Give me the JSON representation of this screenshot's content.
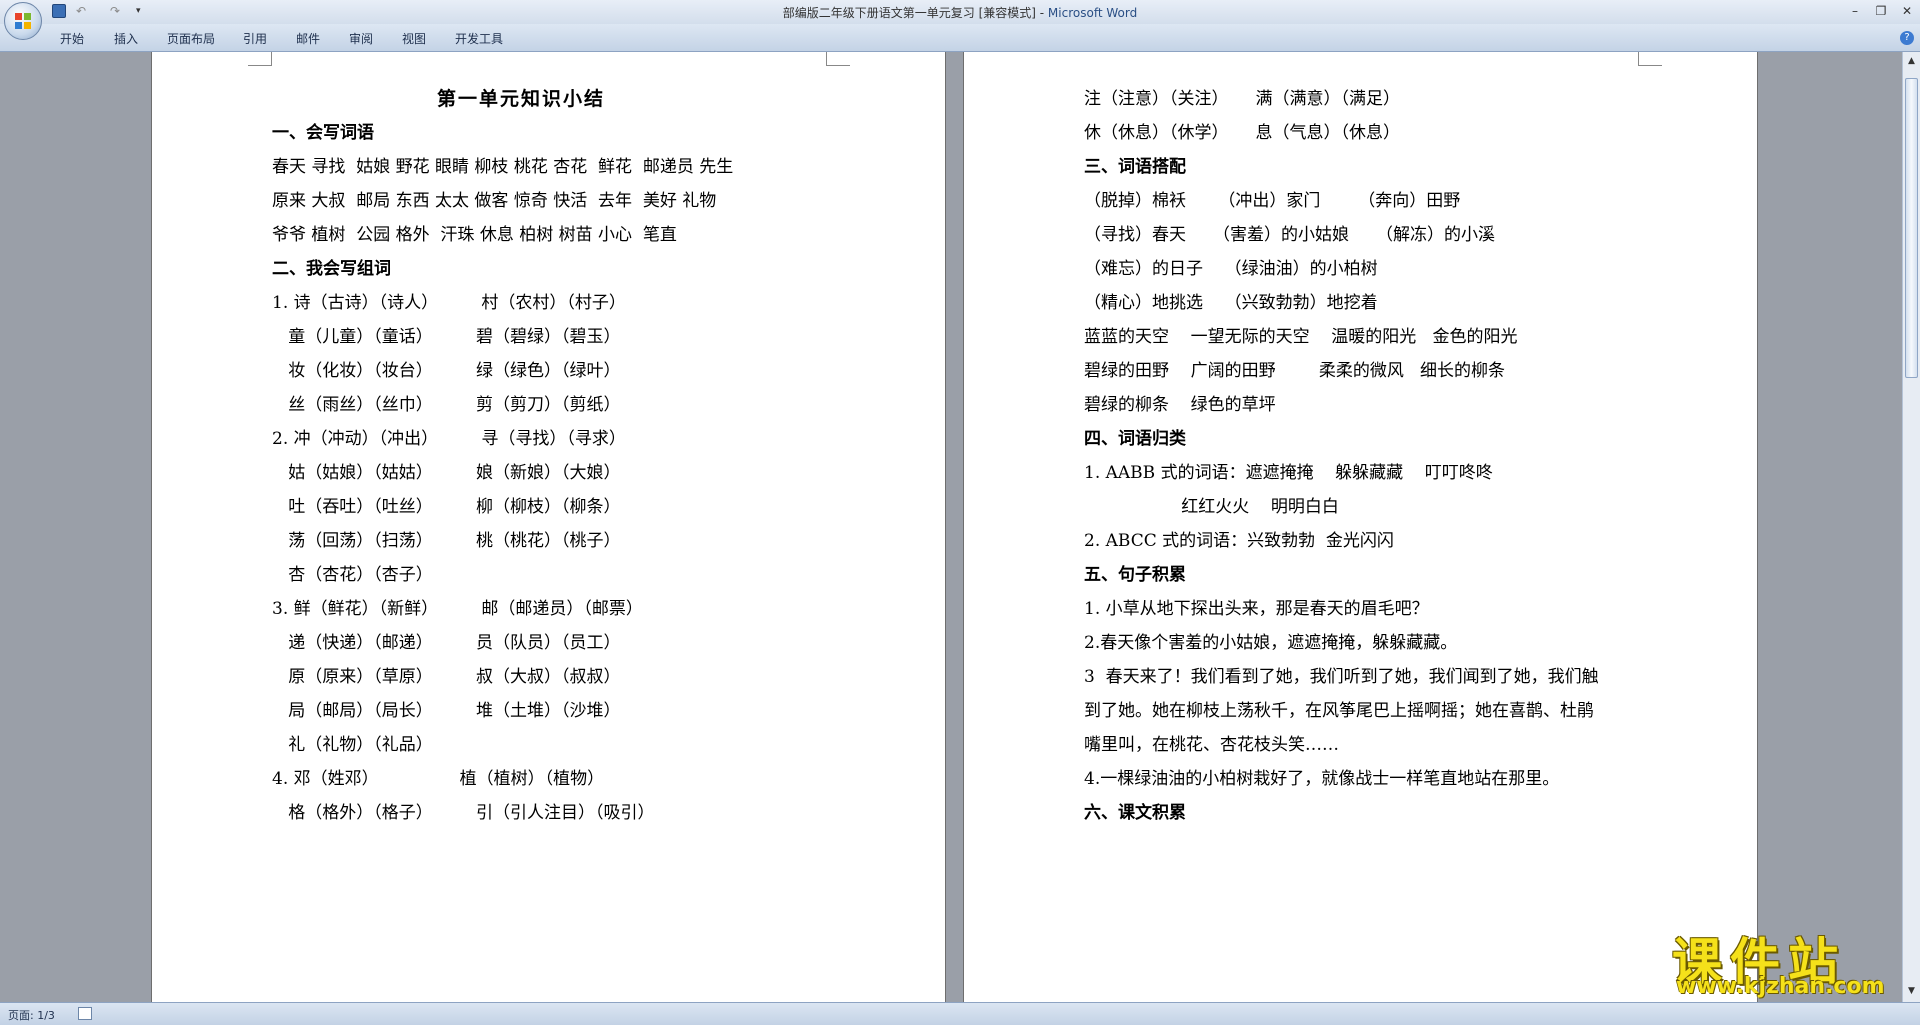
{
  "window": {
    "title_doc": "部编版二年级下册语文第一单元复习 [兼容模式] - ",
    "title_app": "Microsoft Word",
    "controls": [
      "–",
      "❐",
      "✕"
    ]
  },
  "qat": {
    "undo": "↶",
    "redo": "↷",
    "more": "▾"
  },
  "ribbon": {
    "tabs": [
      "开始",
      "插入",
      "页面布局",
      "引用",
      "邮件",
      "审阅",
      "视图",
      "开发工具"
    ],
    "help": "?"
  },
  "left_page": {
    "title": "第一单元知识小结",
    "lines": [
      "一、会写词语",
      "春天 寻找  姑娘 野花 眼睛 柳枝 桃花 杏花  鲜花  邮递员 先生",
      "原来 大叔  邮局 东西 太太 做客 惊奇 快活  去年  美好 礼物",
      "爷爷 植树  公园 格外  汗珠 休息 柏树 树苗 小心  笔直",
      "二、我会写组词",
      "1. 诗（古诗）（诗人）        村（农村）（村子）",
      "   童（儿童）（童话）        碧（碧绿）（碧玉）",
      "   妆（化妆）（妆台）        绿（绿色）（绿叶）",
      "   丝（雨丝）（丝巾）        剪（剪刀）（剪纸）",
      "2. 冲（冲动）（冲出）        寻（寻找）（寻求）",
      "   姑（姑娘）（姑姑）        娘（新娘）（大娘）",
      "   吐（吞吐）（吐丝）        柳（柳枝）（柳条）",
      "   荡（回荡）（扫荡）        桃（桃花）（桃子）",
      "   杏（杏花）（杏子）",
      "3. 鲜（鲜花）（新鲜）        邮（邮递员）（邮票）",
      "   递（快递）（邮递）        员（队员）（员工）",
      "   原（原来）（草原）        叔（大叔）（叔叔）",
      "   局（邮局）（局长）        堆（土堆）（沙堆）",
      "   礼（礼物）（礼品）",
      "4. 邓（姓邓）               植（植树）（植物）",
      "   格（格外）（格子）        引（引人注目）（吸引）"
    ]
  },
  "right_page": {
    "lines": [
      "注（注意）（关注）     满（满意）（满足）",
      "休（休息）（休学）     息（气息）（休息）",
      "三、词语搭配",
      "（脱掉）棉袄      （冲出）家门       （奔向）田野",
      "（寻找）春天     （害羞）的小姑娘     （解冻）的小溪",
      "（难忘）的日子    （绿油油）的小柏树",
      "（精心）地挑选    （兴致勃勃）地挖着",
      "蓝蓝的天空    一望无际的天空    温暖的阳光   金色的阳光",
      "碧绿的田野    广阔的田野        柔柔的微风   细长的柳条",
      "碧绿的柳条    绿色的草坪",
      "四、词语归类",
      "1. AABB 式的词语：遮遮掩掩    躲躲藏藏    叮叮咚咚",
      "                  红红火火    明明白白",
      "2. ABCC 式的词语：兴致勃勃  金光闪闪",
      "五、句子积累",
      "1. 小草从地下探出头来，那是春天的眉毛吧？",
      "2.春天像个害羞的小姑娘，遮遮掩掩，躲躲藏藏。",
      "3  春天来了！我们看到了她，我们听到了她，我们闻到了她，我们触",
      "到了她。她在柳枝上荡秋千，在风筝尾巴上摇啊摇；她在喜鹊、杜鹃",
      "嘴里叫，在桃花、杏花枝头笑……",
      "4.一棵绿油油的小柏树栽好了，就像战士一样笔直地站在那里。",
      "六、课文积累"
    ]
  },
  "status": {
    "page": "页面: 1/3"
  },
  "watermark": {
    "big": "课件站",
    "url": "www.kjzhan.com"
  }
}
